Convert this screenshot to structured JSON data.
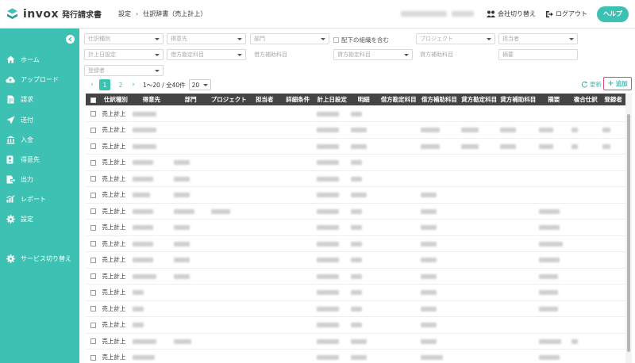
{
  "app": {
    "logo_text": "invox",
    "logo_sub": "発行請求書",
    "breadcrumb": [
      "設定",
      "仕訳辞書（売上計上）"
    ],
    "switch_company": "会社切り替え",
    "logout": "ログアウト",
    "help": "ヘルプ"
  },
  "colors": {
    "accent": "#3dc1b3",
    "header_dark": "#444444",
    "highlight": "#e04a7a"
  },
  "sidebar": {
    "items": [
      {
        "label": "ホーム",
        "icon": "home-icon"
      },
      {
        "label": "アップロード",
        "icon": "cloud-upload-icon"
      },
      {
        "label": "請求",
        "icon": "document-icon"
      },
      {
        "label": "送付",
        "icon": "send-icon"
      },
      {
        "label": "入金",
        "icon": "bank-icon"
      },
      {
        "label": "得意先",
        "icon": "contacts-icon"
      },
      {
        "label": "出力",
        "icon": "export-icon"
      },
      {
        "label": "レポート",
        "icon": "report-icon"
      },
      {
        "label": "設定",
        "icon": "gear-icon"
      },
      {
        "label": "サービス切り替え",
        "icon": "switch-icon"
      }
    ]
  },
  "filters": {
    "journal_type": "仕訳種別",
    "customer": "得意先",
    "department": "部門",
    "include_sub": "配下の組織を含む",
    "project": "プロジェクト",
    "person": "担当者",
    "posting_date": "計上日設定",
    "debit_account": "借方勘定科目",
    "debit_sub": "借方補助科目",
    "credit_account": "貸方勘定科目",
    "credit_sub": "貸方補助科目",
    "summary": "摘要",
    "registrant": "登録者"
  },
  "pager": {
    "pages": [
      "1",
      "2"
    ],
    "prev": "‹",
    "next": "›",
    "info": "1〜20 / 全40件",
    "page_size": "20",
    "refresh": "更新",
    "add": "追加"
  },
  "table": {
    "columns": [
      "仕訳種別",
      "得意先",
      "部門",
      "プロジェクト",
      "担当者",
      "詳細条件",
      "計上日設定",
      "明細",
      "借方勘定科目",
      "借方補助科目",
      "貸方勘定科目",
      "貸方補助科目",
      "摘要",
      "複合仕訳",
      "登録者"
    ],
    "row_type": "売上計上",
    "row_count": 16
  }
}
